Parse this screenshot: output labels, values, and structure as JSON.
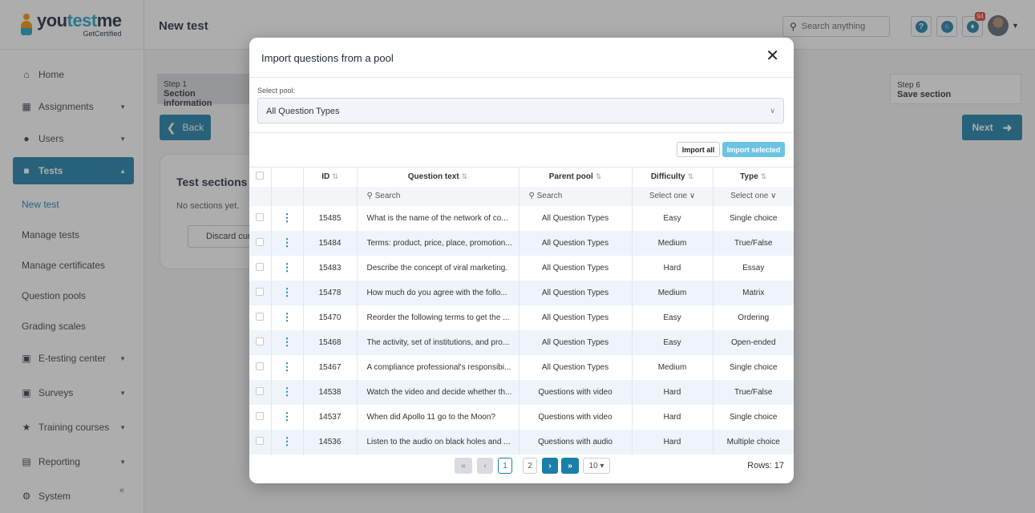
{
  "app": {
    "logo_word_1": "you",
    "logo_word_2": "test",
    "logo_word_3": "me",
    "logo_sub": "GetCertified"
  },
  "sidebar": {
    "items": [
      {
        "label": "Home",
        "icon": "home-icon"
      },
      {
        "label": "Assignments",
        "icon": "assignments-icon"
      },
      {
        "label": "Users",
        "icon": "users-icon"
      },
      {
        "label": "Tests",
        "icon": "tests-icon"
      }
    ],
    "sub_items": [
      "New test",
      "Manage tests",
      "Manage certificates",
      "Question pools",
      "Grading scales"
    ],
    "items_bottom": [
      {
        "label": "E-testing center",
        "icon": "e-testing-icon"
      },
      {
        "label": "Surveys",
        "icon": "surveys-icon"
      },
      {
        "label": "Training courses",
        "icon": "trophy-icon"
      },
      {
        "label": "Reporting",
        "icon": "reporting-icon"
      },
      {
        "label": "System",
        "icon": "gear-icon"
      }
    ]
  },
  "header": {
    "page_title": "New test",
    "search_placeholder": "Search anything",
    "notification_count": "94"
  },
  "wizard": {
    "step1_num": "Step 1",
    "step1_label": "Section information",
    "step6_num": "Step 6",
    "step6_label": "Save section",
    "back_label": "Back",
    "next_label": "Next"
  },
  "sections_card": {
    "title": "Test sections",
    "empty_text": "No sections yet.",
    "discard_label": "Discard curre"
  },
  "modal": {
    "title": "Import questions from a pool",
    "select_label": "Select pool:",
    "select_value": "All Question Types",
    "import_all": "Import all",
    "import_selected": "Import selected",
    "columns": [
      "ID",
      "Question text",
      "Parent pool",
      "Difficulty",
      "Type"
    ],
    "filters": {
      "search_1": "Search",
      "search_2": "Search",
      "select_1": "Select one",
      "select_2": "Select one"
    },
    "rows": [
      {
        "id": "15485",
        "text": "What is the name of the network of co...",
        "pool": "All Question Types",
        "difficulty": "Easy",
        "type": "Single choice"
      },
      {
        "id": "15484",
        "text": "Terms: product, price, place, promotion...",
        "pool": "All Question Types",
        "difficulty": "Medium",
        "type": "True/False"
      },
      {
        "id": "15483",
        "text": "Describe the concept of viral marketing.",
        "pool": "All Question Types",
        "difficulty": "Hard",
        "type": "Essay"
      },
      {
        "id": "15478",
        "text": "How much do you agree with the follo...",
        "pool": "All Question Types",
        "difficulty": "Medium",
        "type": "Matrix"
      },
      {
        "id": "15470",
        "text": "Reorder the following terms to get the ...",
        "pool": "All Question Types",
        "difficulty": "Easy",
        "type": "Ordering"
      },
      {
        "id": "15468",
        "text": "The activity, set of institutions, and pro...",
        "pool": "All Question Types",
        "difficulty": "Easy",
        "type": "Open-ended"
      },
      {
        "id": "15467",
        "text": "A compliance professional's responsibi...",
        "pool": "All Question Types",
        "difficulty": "Medium",
        "type": "Single choice"
      },
      {
        "id": "14538",
        "text": "Watch the video and decide whether th...",
        "pool": "Questions with video",
        "difficulty": "Hard",
        "type": "True/False"
      },
      {
        "id": "14537",
        "text": "When did Apollo 11 go to the Moon?",
        "pool": "Questions with video",
        "difficulty": "Hard",
        "type": "Single choice"
      },
      {
        "id": "14536",
        "text": "Listen to the audio on black holes and ...",
        "pool": "Questions with audio",
        "difficulty": "Hard",
        "type": "Multiple choice"
      }
    ],
    "pager": {
      "page_1": "1",
      "page_2": "2",
      "page_size": "10",
      "rows_info": "Rows: 17"
    }
  }
}
